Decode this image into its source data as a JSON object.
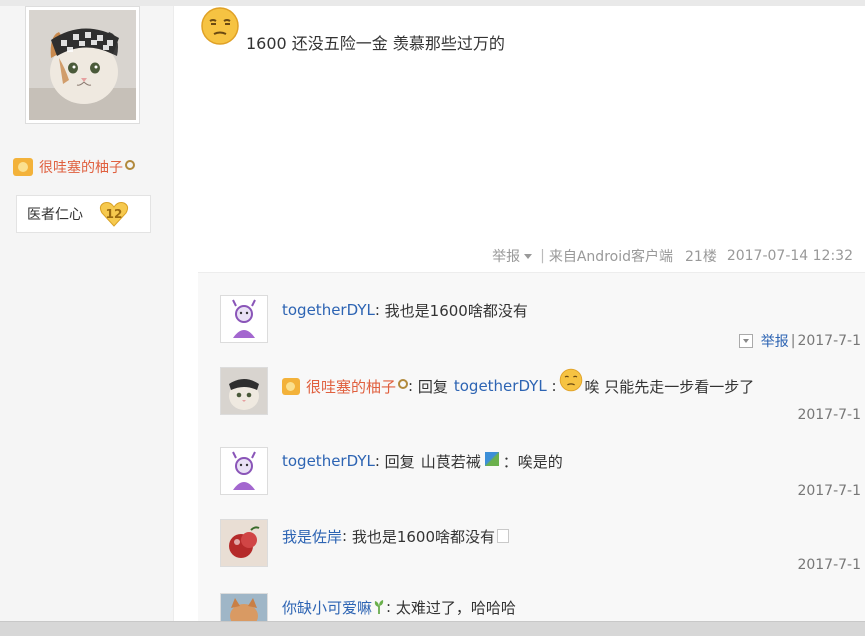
{
  "author": {
    "name": "很哇塞的柚子",
    "level_title": "医者仁心",
    "level_number": "12"
  },
  "post": {
    "text": "1600 还没五险一金 羡慕那些过万的",
    "report_label": "举报",
    "separator": "|",
    "client": "来自Android客户端",
    "floor": "21楼",
    "datetime": "2017-07-14 12:32"
  },
  "replies": [
    {
      "user": "togetherDYL",
      "text": "我也是1600啥都没有",
      "report_label": "举报",
      "separator": "|",
      "date": "2017-7-1"
    },
    {
      "user": "很哇塞的柚子",
      "reply_word": "回复",
      "reply_to": "togetherDYL",
      "text": "唉 只能先走一步看一步了",
      "date": "2017-7-1"
    },
    {
      "user": "togetherDYL",
      "reply_word": "回复",
      "reply_to": "山茛若祴",
      "text": "：唉是的",
      "date": "2017-7-1"
    },
    {
      "user": "我是佐岸",
      "text": "我也是1600啥都没有",
      "date": "2017-7-1"
    },
    {
      "user": "你缺小可爱嘛",
      "text": "太难过了，哈哈哈"
    }
  ],
  "colors": {
    "link_blue": "#2d64b3",
    "vip_name_red": "#e0603f",
    "meta_gray": "#999999",
    "emoji_yellow": "#f6c342"
  }
}
